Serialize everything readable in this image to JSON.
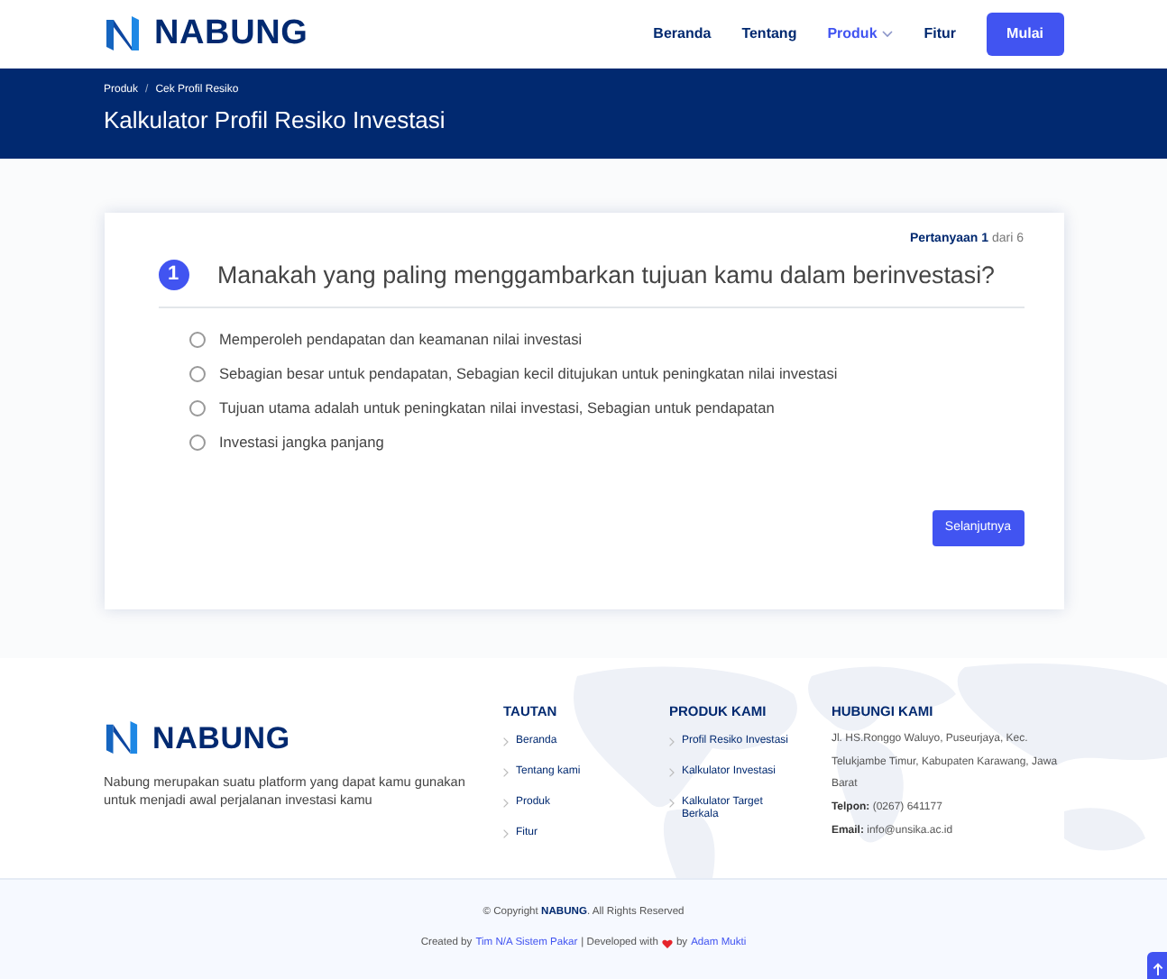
{
  "navbar": {
    "brand": "NABUNG",
    "items": [
      {
        "label": "Beranda",
        "selected": false,
        "dropdown": false
      },
      {
        "label": "Tentang",
        "selected": false,
        "dropdown": false
      },
      {
        "label": "Produk",
        "selected": true,
        "dropdown": true
      },
      {
        "label": "Fitur",
        "selected": false,
        "dropdown": false
      }
    ],
    "cta": "Mulai"
  },
  "page_header": {
    "breadcrumb": [
      "Produk",
      "Cek Profil Resiko"
    ],
    "breadcrumb_separator": "/",
    "title": "Kalkulator Profil Resiko Investasi"
  },
  "quiz": {
    "progress": "**Pertanyaan 1** dari 6",
    "number": "1",
    "question": "Manakah yang paling menggambarkan tujuan kamu dalam berinvestasi?",
    "options": [
      {
        "label": "Memperoleh pendapatan dan keamanan nilai investasi",
        "selected": false
      },
      {
        "label": "Sebagian besar untuk pendapatan, Sebagian kecil ditujukan untuk peningkatan nilai investasi",
        "selected": false
      },
      {
        "label": "Tujuan utama adalah untuk peningkatan nilai investasi, Sebagian untuk pendapatan",
        "selected": false
      },
      {
        "label": "Investasi jangka panjang",
        "selected": false
      }
    ],
    "next_button": "Selanjutnya"
  },
  "footer": {
    "brand": "NABUNG",
    "about": "Nabung merupakan suatu platform yang dapat kamu gunakan untuk menjadi awal perjalanan investasi kamu",
    "columns": [
      {
        "heading": "TAUTAN",
        "links": [
          "Beranda",
          "Tentang kami",
          "Produk",
          "Fitur"
        ]
      },
      {
        "heading": "PRODUK KAMI",
        "links": [
          "Profil Resiko Investasi",
          "Kalkulator Investasi",
          "Kalkulator Target Berkala"
        ]
      }
    ],
    "contact": {
      "heading": "HUBUNGI KAMI",
      "address": "Jl. HS.Ronggo Waluyo, Puseurjaya, Kec. Telukjambe Timur, Kabupaten Karawang, Jawa Barat",
      "phone": "**Telpon:** (0267) 641177",
      "email": "**Email:** info@unsika.ac.id"
    },
    "copyright": "© Copyright **NABUNG**. All Rights Reserved",
    "credits": {
      "prefix": "Created by",
      "team": "Tim N/A Sistem Pakar",
      "middle": "| Developed with",
      "after_heart": "by",
      "author": "Adam Mukti"
    }
  }
}
